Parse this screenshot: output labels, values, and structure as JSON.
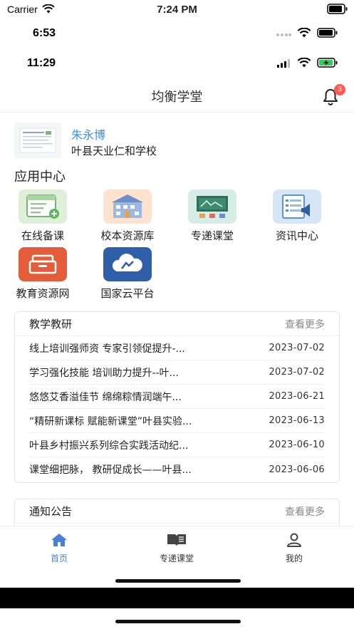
{
  "status1": {
    "carrier": "Carrier",
    "time": "7:24 PM"
  },
  "status2": {
    "time": "6:53"
  },
  "status3": {
    "time": "11:29"
  },
  "nav": {
    "title": "均衡学堂",
    "badge": "3"
  },
  "profile": {
    "name": "朱永博",
    "school": "叶县天业仁和学校"
  },
  "app_center": {
    "title": "应用中心",
    "items": [
      {
        "label": "在线备课",
        "icon": "online-lesson-icon"
      },
      {
        "label": "校本资源库",
        "icon": "school-resource-icon"
      },
      {
        "label": "专递课堂",
        "icon": "classroom-icon"
      },
      {
        "label": "资讯中心",
        "icon": "news-center-icon"
      },
      {
        "label": "教育资源网",
        "icon": "education-resource-icon"
      },
      {
        "label": "国家云平台",
        "icon": "cloud-platform-icon"
      }
    ]
  },
  "teaching": {
    "title": "教学教研",
    "more": "查看更多",
    "rows": [
      {
        "title": "线上培训强师资 专家引领促提升-...",
        "date": "2023-07-02"
      },
      {
        "title": "学习强化技能 培训助力提升--叶...",
        "date": "2023-07-02"
      },
      {
        "title": "悠悠艾香溢佳节 绵绵粽情润端午...",
        "date": "2023-06-21"
      },
      {
        "title": "“精研新课标 赋能新课堂”叶县实验...",
        "date": "2023-06-13"
      },
      {
        "title": "叶县乡村振兴系列综合实践活动纪...",
        "date": "2023-06-10"
      },
      {
        "title": "课堂细把脉， 教研促成长——叶县...",
        "date": "2023-06-06"
      }
    ]
  },
  "notice": {
    "title": "通知公告",
    "more": "查看更多"
  },
  "tabs": [
    {
      "label": "首页",
      "active": true
    },
    {
      "label": "专递课堂",
      "active": false
    },
    {
      "label": "我的",
      "active": false
    }
  ],
  "colors": {
    "accent": "#4a7fd6",
    "name": "#3a8ee6",
    "badge": "#ff5a4f"
  }
}
